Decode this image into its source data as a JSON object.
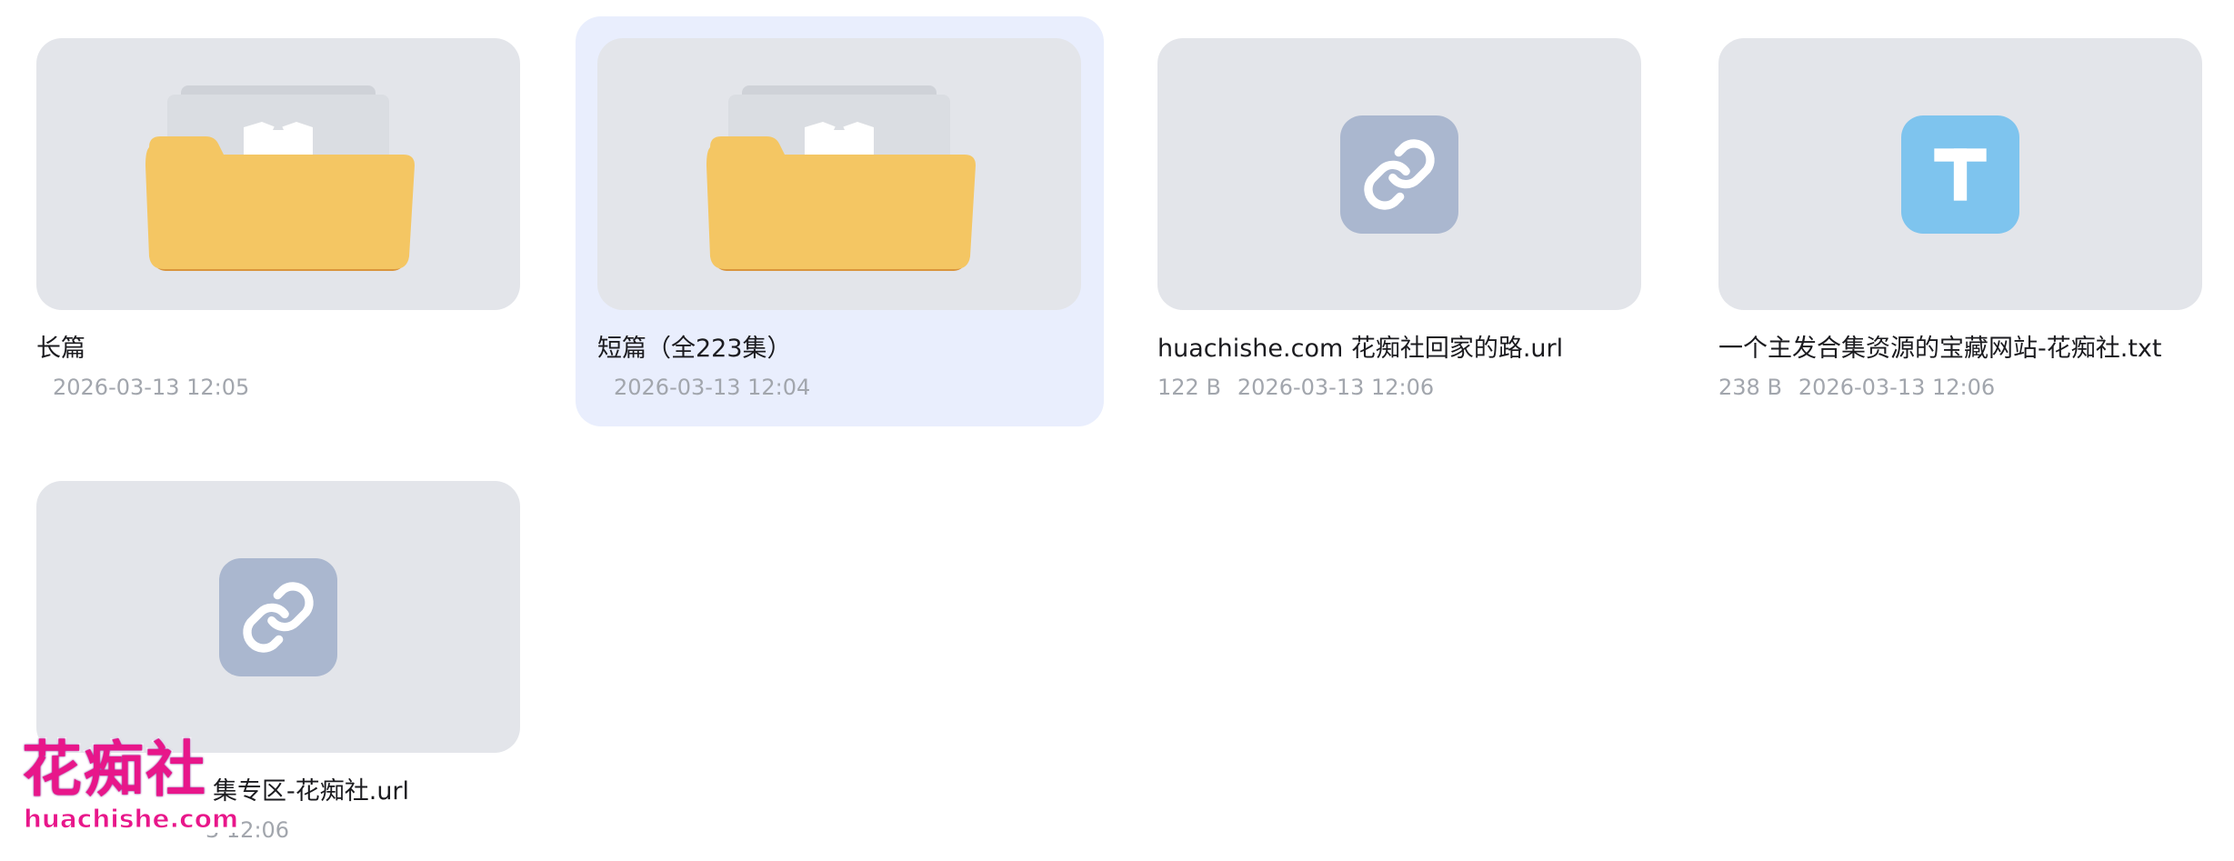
{
  "files": [
    {
      "name": "长篇",
      "size": "",
      "date": "2026-03-13 12:05",
      "type": "folder",
      "selected": false
    },
    {
      "name": "短篇（全223集）",
      "size": "",
      "date": "2026-03-13 12:04",
      "type": "folder",
      "selected": true
    },
    {
      "name": "huachishe.com 花痴社回家的路.url",
      "size": "122 B",
      "date": "2026-03-13 12:06",
      "type": "link",
      "selected": false
    },
    {
      "name": "一个主发合集资源的宝藏网站-花痴社.txt",
      "size": "238 B",
      "date": "2026-03-13 12:06",
      "type": "text",
      "selected": false
    },
    {
      "name": "集专区-花痴社.url",
      "size": "",
      "date": "3 12:06",
      "type": "link",
      "selected": false
    }
  ],
  "icons": {
    "folder": "folder-icon",
    "link": "link-icon",
    "text": "text-file-icon"
  },
  "colors": {
    "thumb_bg": "#e3e5ea",
    "selected_bg": "#e9eefd",
    "folder_front": "#f4c663",
    "folder_back": "#d9953d",
    "link_icon_bg": "#aab7cf",
    "text_icon_bg": "#7ec4ee",
    "meta_text": "#a2a6ad",
    "watermark": "#e8168a"
  },
  "watermark": {
    "logo_text": "花痴社",
    "url_text": "huachishe.com"
  }
}
